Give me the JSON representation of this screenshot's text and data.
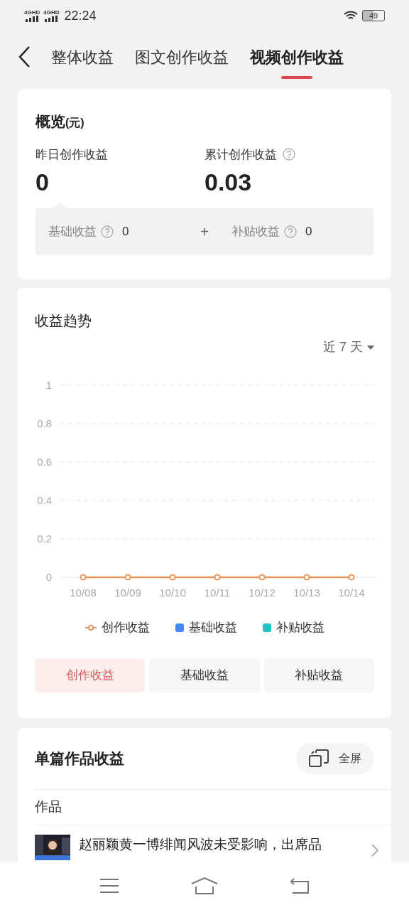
{
  "status_bar": {
    "signals": [
      "4GHD",
      "4GHD"
    ],
    "time": "22:24",
    "battery": "49"
  },
  "tabs": [
    {
      "label": "整体收益",
      "selected": false
    },
    {
      "label": "图文创作收益",
      "selected": false
    },
    {
      "label": "视频创作收益",
      "selected": true
    }
  ],
  "overview": {
    "title": "概览",
    "unit": "(元)",
    "stats": [
      {
        "label": "昨日创作收益",
        "value": "0",
        "help": false
      },
      {
        "label": "累计创作收益",
        "value": "0.03",
        "help": true
      }
    ],
    "breakdown": [
      {
        "label": "基础收益",
        "value": "0"
      },
      {
        "label": "补贴收益",
        "value": "0"
      }
    ],
    "operator": "+"
  },
  "trend": {
    "title": "收益趋势",
    "range": "近 7 天",
    "chart_data": {
      "type": "line",
      "categories": [
        "10/08",
        "10/09",
        "10/10",
        "10/11",
        "10/12",
        "10/13",
        "10/14"
      ],
      "ylim": [
        0,
        1
      ],
      "yticks": [
        0,
        0.2,
        0.4,
        0.6,
        0.8,
        1
      ],
      "grid": true,
      "series": [
        {
          "name": "创作收益",
          "color": "#e8955a",
          "marker": "circle",
          "values": [
            0,
            0,
            0,
            0,
            0,
            0,
            0
          ]
        }
      ]
    },
    "legend": [
      {
        "label": "基础收益",
        "kind": "square",
        "color": "#4589f0"
      },
      {
        "label": "补贴收益",
        "kind": "square",
        "color": "#1ec2be"
      }
    ],
    "toggles": [
      {
        "label": "创作收益",
        "selected": true
      },
      {
        "label": "基础收益",
        "selected": false
      },
      {
        "label": "补贴收益",
        "selected": false
      }
    ]
  },
  "works": {
    "title": "单篇作品收益",
    "fullscreen": "全屏",
    "column": "作品",
    "items": [
      {
        "kind": "picture",
        "title": "赵丽颖黄一博绯闻风波未受影响，出席品"
      }
    ]
  }
}
